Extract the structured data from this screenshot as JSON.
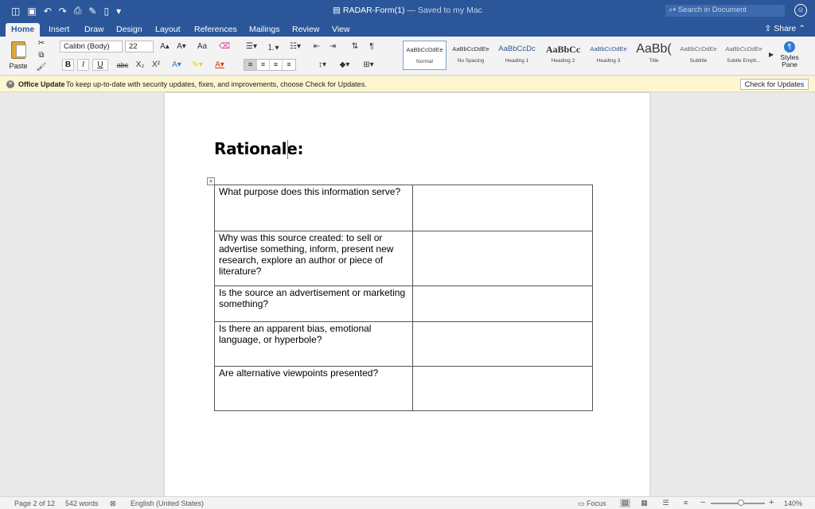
{
  "titlebar": {
    "doc_name": "RADAR-Form(1)",
    "saved_status": " — Saved to my Mac",
    "search_placeholder": "Search in Document",
    "qat_icons": [
      "sidebar-icon",
      "save-icon",
      "undo-icon",
      "redo-icon",
      "print-icon",
      "edit-icon",
      "new-doc-icon",
      "customize-icon"
    ]
  },
  "tabs": [
    {
      "label": "Home",
      "active": true
    },
    {
      "label": "Insert"
    },
    {
      "label": "Draw"
    },
    {
      "label": "Design"
    },
    {
      "label": "Layout"
    },
    {
      "label": "References"
    },
    {
      "label": "Mailings"
    },
    {
      "label": "Review"
    },
    {
      "label": "View"
    }
  ],
  "share_label": "Share",
  "ribbon": {
    "paste_label": "Paste",
    "font_name": "Calibri (Body)",
    "font_size": "22",
    "styles": [
      {
        "preview": "AaBbCcDdEe",
        "name": "Normal",
        "selected": true
      },
      {
        "preview": "AaBbCcDdEe",
        "name": "No Spacing"
      },
      {
        "preview": "AaBbCcDc",
        "name": "Heading 1"
      },
      {
        "preview": "AaBbCc",
        "name": "Heading 2"
      },
      {
        "preview": "AaBbCcDdEe",
        "name": "Heading 3"
      },
      {
        "preview": "AaBb(",
        "name": "Title"
      },
      {
        "preview": "AaBbCcDdEe",
        "name": "Subtitle"
      },
      {
        "preview": "AaBbCcDdEe",
        "name": "Subtle Emph..."
      }
    ],
    "styles_pane_label": "Styles Pane"
  },
  "message_bar": {
    "title": "Office Update",
    "text": "To keep up-to-date with security updates, fixes, and improvements, choose Check for Updates.",
    "button": "Check for Updates"
  },
  "document": {
    "heading": "Rationale:",
    "table_rows": [
      {
        "question": "What purpose does this information serve?",
        "answer": ""
      },
      {
        "question": "Why was this source created: to sell or advertise something, inform, present new research, explore an author or piece of literature?",
        "answer": ""
      },
      {
        "question": "Is the source an advertisement or marketing something?",
        "answer": ""
      },
      {
        "question": "Is there an apparent bias, emotional language, or hyperbole?",
        "answer": ""
      },
      {
        "question": "Are alternative viewpoints presented?",
        "answer": ""
      }
    ]
  },
  "statusbar": {
    "page": "Page 2 of 12",
    "words": "542 words",
    "language": "English (United States)",
    "focus": "Focus",
    "zoom": "140%"
  }
}
